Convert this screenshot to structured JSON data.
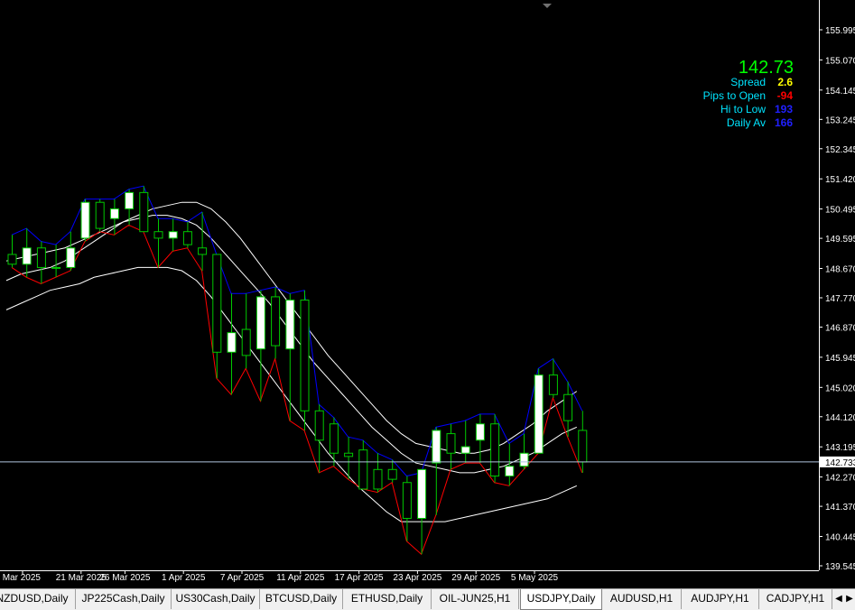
{
  "chart": {
    "symbol_timeframe": "USDJPY,Daily",
    "colors": {
      "background": "#000000",
      "bull_candle": "#ffffff",
      "bear_candle": "#000000",
      "wick": "#00c800",
      "upper_line": "#0000ff",
      "lower_line": "#ff0000",
      "band": "#ffffff",
      "axis_text": "#ffffff",
      "current_line": "#b0c4de"
    },
    "price_axis": {
      "labels": [
        "155.995",
        "155.070",
        "154.145",
        "153.245",
        "152.345",
        "151.420",
        "150.495",
        "149.595",
        "148.670",
        "147.770",
        "146.870",
        "145.945",
        "145.020",
        "144.120",
        "143.195",
        "142.270",
        "141.370",
        "140.445",
        "139.545"
      ],
      "current_price_label": "142.733",
      "range": [
        139.545,
        155.995
      ]
    },
    "date_axis": {
      "labels": [
        "Mar 2025",
        "21 Mar 2025",
        "26 Mar 2025",
        "1 Apr 2025",
        "7 Apr 2025",
        "11 Apr 2025",
        "17 Apr 2025",
        "23 Apr 2025",
        "29 Apr 2025",
        "5 May 2025"
      ]
    },
    "info_panel": {
      "price": "142.73",
      "price_color": "#00ff00",
      "rows": [
        {
          "label": "Spread",
          "value": "2.6",
          "label_color": "#00e5ff",
          "value_color": "#ffff00"
        },
        {
          "label": "Pips to Open",
          "value": "-94",
          "label_color": "#00e5ff",
          "value_color": "#ff0000"
        },
        {
          "label": "Hi to Low",
          "value": "193",
          "label_color": "#00e5ff",
          "value_color": "#2020ff"
        },
        {
          "label": "Daily Av",
          "value": "166",
          "label_color": "#00e5ff",
          "value_color": "#2020ff"
        }
      ]
    }
  },
  "tabs": [
    {
      "label": "NZDUSD,Daily",
      "active": false
    },
    {
      "label": "JP225Cash,Daily",
      "active": false
    },
    {
      "label": "US30Cash,Daily",
      "active": false
    },
    {
      "label": "BTCUSD,Daily",
      "active": false
    },
    {
      "label": "ETHUSD,Daily",
      "active": false
    },
    {
      "label": "OIL-JUN25,H1",
      "active": false
    },
    {
      "label": "USDJPY,Daily",
      "active": true
    },
    {
      "label": "AUDUSD,H1",
      "active": false
    },
    {
      "label": "AUDJPY,H1",
      "active": false
    },
    {
      "label": "CADJPY,H1",
      "active": false
    }
  ],
  "chart_data": {
    "type": "candlestick",
    "candles": [
      {
        "date": "2025-03-17",
        "open": 149.1,
        "high": 149.7,
        "low": 148.7,
        "close": 148.8
      },
      {
        "date": "2025-03-18",
        "open": 148.8,
        "high": 149.9,
        "low": 148.4,
        "close": 149.3
      },
      {
        "date": "2025-03-19",
        "open": 149.3,
        "high": 149.5,
        "low": 148.2,
        "close": 148.7
      },
      {
        "date": "2025-03-20",
        "open": 148.7,
        "high": 149.4,
        "low": 148.4,
        "close": 148.7
      },
      {
        "date": "2025-03-21",
        "open": 148.7,
        "high": 149.8,
        "low": 148.6,
        "close": 149.3
      },
      {
        "date": "2025-03-24",
        "open": 149.6,
        "high": 150.8,
        "low": 149.5,
        "close": 150.7
      },
      {
        "date": "2025-03-25",
        "open": 150.7,
        "high": 150.8,
        "low": 149.8,
        "close": 149.9
      },
      {
        "date": "2025-03-26",
        "open": 150.2,
        "high": 150.8,
        "low": 149.7,
        "close": 150.5
      },
      {
        "date": "2025-03-27",
        "open": 150.5,
        "high": 151.1,
        "low": 150.0,
        "close": 151.0
      },
      {
        "date": "2025-03-28",
        "open": 151.0,
        "high": 151.2,
        "low": 149.8,
        "close": 149.8
      },
      {
        "date": "2025-03-31",
        "open": 149.8,
        "high": 150.2,
        "low": 148.7,
        "close": 149.6
      },
      {
        "date": "2025-04-01",
        "open": 149.6,
        "high": 150.2,
        "low": 149.2,
        "close": 149.8
      },
      {
        "date": "2025-04-02",
        "open": 149.8,
        "high": 150.1,
        "low": 149.3,
        "close": 149.4
      },
      {
        "date": "2025-04-03",
        "open": 149.3,
        "high": 150.4,
        "low": 148.6,
        "close": 149.1
      },
      {
        "date": "2025-04-04",
        "open": 149.1,
        "high": 149.1,
        "low": 145.3,
        "close": 146.1
      },
      {
        "date": "2025-04-07",
        "open": 146.1,
        "high": 147.9,
        "low": 144.8,
        "close": 146.7
      },
      {
        "date": "2025-04-08",
        "open": 146.8,
        "high": 147.9,
        "low": 145.6,
        "close": 146.0
      },
      {
        "date": "2025-04-09",
        "open": 146.2,
        "high": 148.0,
        "low": 144.6,
        "close": 147.8
      },
      {
        "date": "2025-04-10",
        "open": 147.8,
        "high": 148.1,
        "low": 145.9,
        "close": 146.3
      },
      {
        "date": "2025-04-11",
        "open": 146.2,
        "high": 147.9,
        "low": 144.0,
        "close": 147.7
      },
      {
        "date": "2025-04-14",
        "open": 147.7,
        "high": 148.0,
        "low": 143.7,
        "close": 144.3
      },
      {
        "date": "2025-04-15",
        "open": 144.3,
        "high": 144.5,
        "low": 142.4,
        "close": 143.4
      },
      {
        "date": "2025-04-16",
        "open": 143.9,
        "high": 144.1,
        "low": 142.6,
        "close": 143.0
      },
      {
        "date": "2025-04-17",
        "open": 143.0,
        "high": 143.5,
        "low": 142.2,
        "close": 142.9
      },
      {
        "date": "2025-04-18",
        "open": 143.1,
        "high": 143.4,
        "low": 141.9,
        "close": 141.9
      },
      {
        "date": "2025-04-21",
        "open": 142.5,
        "high": 143.0,
        "low": 141.8,
        "close": 141.9
      },
      {
        "date": "2025-04-22",
        "open": 142.5,
        "high": 142.8,
        "low": 142.1,
        "close": 142.2
      },
      {
        "date": "2025-04-23",
        "open": 142.1,
        "high": 142.3,
        "low": 140.3,
        "close": 141.0
      },
      {
        "date": "2025-04-24",
        "open": 141.0,
        "high": 142.4,
        "low": 139.9,
        "close": 142.5
      },
      {
        "date": "2025-04-25",
        "open": 142.7,
        "high": 143.8,
        "low": 141.1,
        "close": 143.7
      },
      {
        "date": "2025-04-28",
        "open": 143.6,
        "high": 143.9,
        "low": 142.5,
        "close": 143.0
      },
      {
        "date": "2025-04-29",
        "open": 143.0,
        "high": 144.0,
        "low": 142.7,
        "close": 143.2
      },
      {
        "date": "2025-04-30",
        "open": 143.4,
        "high": 144.2,
        "low": 142.7,
        "close": 143.9
      },
      {
        "date": "2025-05-01",
        "open": 143.9,
        "high": 144.2,
        "low": 142.1,
        "close": 142.3
      },
      {
        "date": "2025-05-02",
        "open": 142.3,
        "high": 143.3,
        "low": 142.0,
        "close": 142.6
      },
      {
        "date": "2025-05-05",
        "open": 142.6,
        "high": 143.6,
        "low": 142.5,
        "close": 143.0
      },
      {
        "date": "2025-05-06",
        "open": 143.0,
        "high": 145.6,
        "low": 143.0,
        "close": 145.4
      },
      {
        "date": "2025-05-07",
        "open": 145.4,
        "high": 145.9,
        "low": 144.7,
        "close": 144.8
      },
      {
        "date": "2025-05-08",
        "open": 144.8,
        "high": 145.2,
        "low": 143.5,
        "close": 144.0
      },
      {
        "date": "2025-05-09",
        "open": 143.7,
        "high": 144.3,
        "low": 142.4,
        "close": 142.73
      }
    ],
    "upper_band": [
      148.3,
      148.5,
      148.6,
      148.7,
      148.9,
      149.2,
      149.5,
      149.8,
      150.1,
      150.3,
      150.5,
      150.6,
      150.7,
      150.7,
      150.5,
      150.1,
      149.6,
      149.0,
      148.4,
      147.8,
      147.2,
      146.6,
      146.0,
      145.5,
      145.0,
      144.5,
      144.0,
      143.6,
      143.3,
      143.2,
      143.1,
      143.0,
      143.0,
      143.1,
      143.3,
      143.6,
      143.9,
      144.3,
      144.6,
      144.9
    ],
    "middle_band": [
      148.9,
      149.0,
      149.1,
      149.2,
      149.3,
      149.5,
      149.7,
      149.9,
      150.1,
      150.2,
      150.3,
      150.3,
      150.2,
      150.0,
      149.6,
      149.1,
      148.6,
      148.1,
      147.6,
      147.0,
      146.4,
      145.8,
      145.3,
      144.8,
      144.3,
      143.8,
      143.4,
      143.0,
      142.7,
      142.6,
      142.5,
      142.4,
      142.4,
      142.5,
      142.6,
      142.8,
      143.0,
      143.3,
      143.6,
      143.8
    ],
    "lower_band": [
      147.4,
      147.6,
      147.8,
      148.0,
      148.1,
      148.2,
      148.4,
      148.5,
      148.6,
      148.7,
      148.7,
      148.7,
      148.6,
      148.3,
      147.8,
      147.2,
      146.6,
      146.0,
      145.4,
      144.8,
      144.2,
      143.6,
      143.0,
      142.5,
      142.0,
      141.6,
      141.2,
      140.9,
      140.9,
      140.9,
      140.9,
      141.0,
      141.1,
      141.2,
      141.3,
      141.4,
      141.5,
      141.6,
      141.8,
      142.0
    ]
  }
}
